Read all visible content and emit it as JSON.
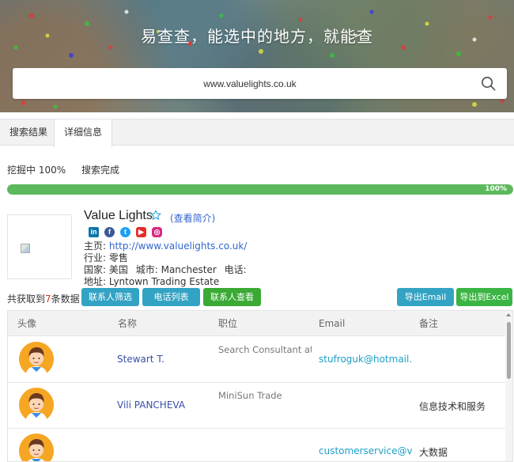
{
  "hero": {
    "title": "易查查，能选中的地方，就能查",
    "search_value": "www.valuelights.co.uk"
  },
  "tabs": [
    {
      "label": "搜索结果",
      "active": false
    },
    {
      "label": "详细信息",
      "active": true
    }
  ],
  "status": {
    "mining": "挖掘中 100%",
    "search": "搜索完成",
    "progress_percent": 100,
    "progress_label": "100%"
  },
  "company": {
    "name": "Value Lights",
    "intro_link": "(查看简介)",
    "socials": [
      "linkedin-icon",
      "facebook-icon",
      "twitter-icon",
      "youtube-icon",
      "instagram-icon"
    ],
    "homepage_label": "主页:",
    "homepage_url": "http://www.valuelights.co.uk/",
    "industry_label": "行业:",
    "industry": "零售",
    "country_label": "国家:",
    "country": "美国",
    "city_label": "城市:",
    "city": "Manchester",
    "phone_label": "电话:",
    "phone": "",
    "address_label": "地址:",
    "address": "Lyntown Trading Estate"
  },
  "actions": {
    "count_prefix": "共获取到",
    "count": "7",
    "count_suffix": "条数据",
    "filter_button": "联系人筛选",
    "phone_list_button": "电话列表",
    "view_button": "联系人查看",
    "export_email_button": "导出Email",
    "export_excel_button": "导出到Excel"
  },
  "table": {
    "headers": [
      "头像",
      "名称",
      "职位",
      "Email",
      "备注"
    ],
    "rows": [
      {
        "name": "Stewart T.",
        "title": "Search Consultant at Ic",
        "email": "stufroguk@hotmail.com",
        "note": ""
      },
      {
        "name": "Vili PANCHEVA",
        "title": "MiniSun Trade",
        "email": "",
        "note": "信息技术和服务"
      },
      {
        "name": "",
        "title": "",
        "email": "customerservice@valuelights.co.uk",
        "note": "大数据"
      }
    ]
  },
  "colors": {
    "progress": "#5cb85c",
    "teal_button": "#33a3c4",
    "green_button": "#3aaa35",
    "link": "#3366cc",
    "email": "#1ea0c8"
  }
}
